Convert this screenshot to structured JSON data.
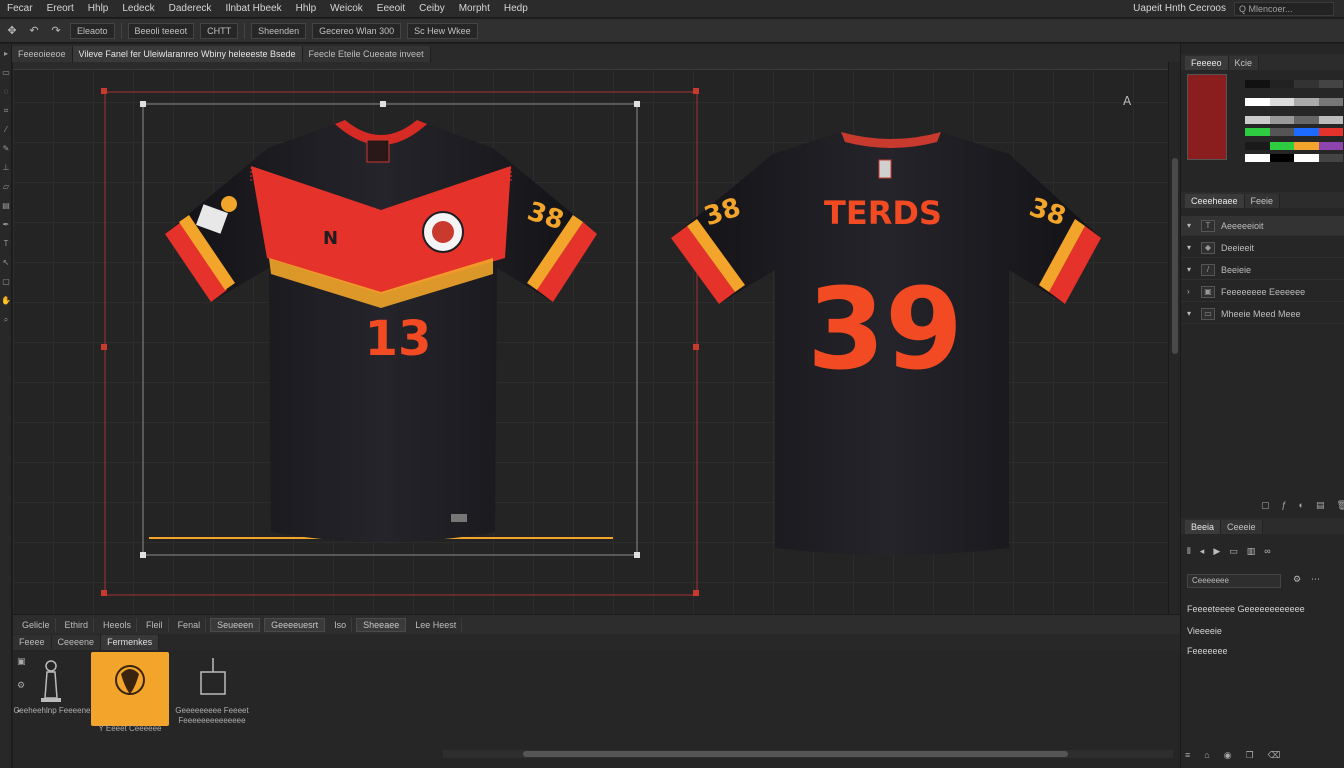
{
  "menu": {
    "items": [
      "Fecar",
      "Ereort",
      "Hhlp",
      "Ledeck",
      "Dadereck",
      "Ilnbat Hbeek",
      "Hhlp",
      "Weicok",
      "Eeeoit",
      "Ceiby",
      "Morpht",
      "Hedp"
    ],
    "workspace": "Uapeit Hnth Cecroos",
    "search_placeholder": "Q Mlencoer..."
  },
  "options_bar": {
    "fields": [
      "Eleaoto",
      "Beeoli teeeot",
      "CHTT",
      "Sheenden",
      "Gecereo Wlan 300",
      "Sc Hew Wkee"
    ]
  },
  "doc_tabs": [
    "Feeeoieeoe",
    "Vileve Fanel fer Uleiwlaranreo Wbiny heleeeste Bsede",
    "Feecle Eteile Cueeate inveet"
  ],
  "canvas": {
    "corner_label": "A",
    "front_jersey": {
      "number": "13",
      "sleeve_number": "38"
    },
    "back_jersey": {
      "name": "TERDS",
      "number": "39",
      "sleeve_left": "38",
      "sleeve_right": "38"
    }
  },
  "status_bar": {
    "items": [
      "Gelicle",
      "Ethird",
      "Heeols",
      "Fleil",
      "Fenal"
    ],
    "fields": [
      "Seueeen",
      "Geeeeuesrt",
      "Iso",
      "Sheeaee",
      "Lee Heest"
    ]
  },
  "library": {
    "tabs": [
      "Feeee",
      "Ceeeene",
      "Fermenkes"
    ],
    "assets": [
      {
        "label": "Ceeheehlnp Feeeene"
      },
      {
        "label": "Y Eeeet Ceeeeee",
        "selected": true
      },
      {
        "label": "Geeeeeeeee Feeeet Feeeeeeeeeeeeee"
      }
    ]
  },
  "right_panel": {
    "swatch_tabs": [
      "Feeeeo",
      "Kcie"
    ],
    "layer_tabs": [
      "Ceeeheaee",
      "Feeie"
    ],
    "layers": [
      {
        "name": "Aeeeeeioit"
      },
      {
        "name": "Deeieeit"
      },
      {
        "name": "Beeieie"
      },
      {
        "name": "Feeeeeeee Eeeeeee"
      },
      {
        "name": "Mheeie Meed Meee"
      }
    ],
    "prop_tabs": [
      "Beeia",
      "Ceeeie"
    ],
    "prop_field": "Ceeeeeee",
    "prop_lines": [
      "Feeeeteeee Geeeeeeeeeeee",
      "Vieeeeie",
      "Feeeeeee"
    ]
  },
  "colors": {
    "accent_orange": "#f2a52a",
    "jersey_red": "#e5322b",
    "jersey_black": "#1d1d22"
  }
}
